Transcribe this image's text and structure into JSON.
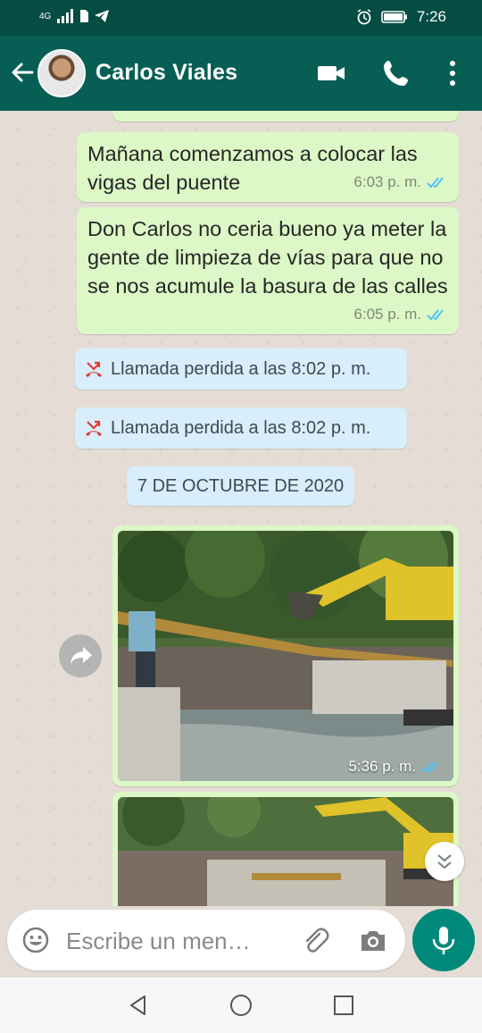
{
  "status_bar": {
    "network": "4G",
    "time": "7:26"
  },
  "header": {
    "contact_name": "Carlos Viales"
  },
  "messages": [
    {
      "text": "Mañana comenzamos a colocar las vigas del puente",
      "time": "6:03 p. m."
    },
    {
      "text": "Don Carlos no ceria bueno ya meter la gente de limpieza de vías para que no se nos acumule la basura de las calles",
      "time": "6:05 p. m."
    }
  ],
  "missed_calls": [
    {
      "text": "Llamada perdida a las 8:02 p. m."
    },
    {
      "text": "Llamada perdida a las 8:02 p. m."
    }
  ],
  "date_separator": "7 DE OCTUBRE DE 2020",
  "photo_message": {
    "time": "5:36 p. m."
  },
  "input": {
    "placeholder": "Escribe un men…"
  },
  "colors": {
    "header": "#075e54",
    "status_bar": "#054d44",
    "outgoing_bubble": "#dcf8c6",
    "system_bubble": "#d8eefb",
    "read_ticks": "#4fc3f7",
    "missed_call": "#e53935",
    "mic_button": "#00897b"
  }
}
